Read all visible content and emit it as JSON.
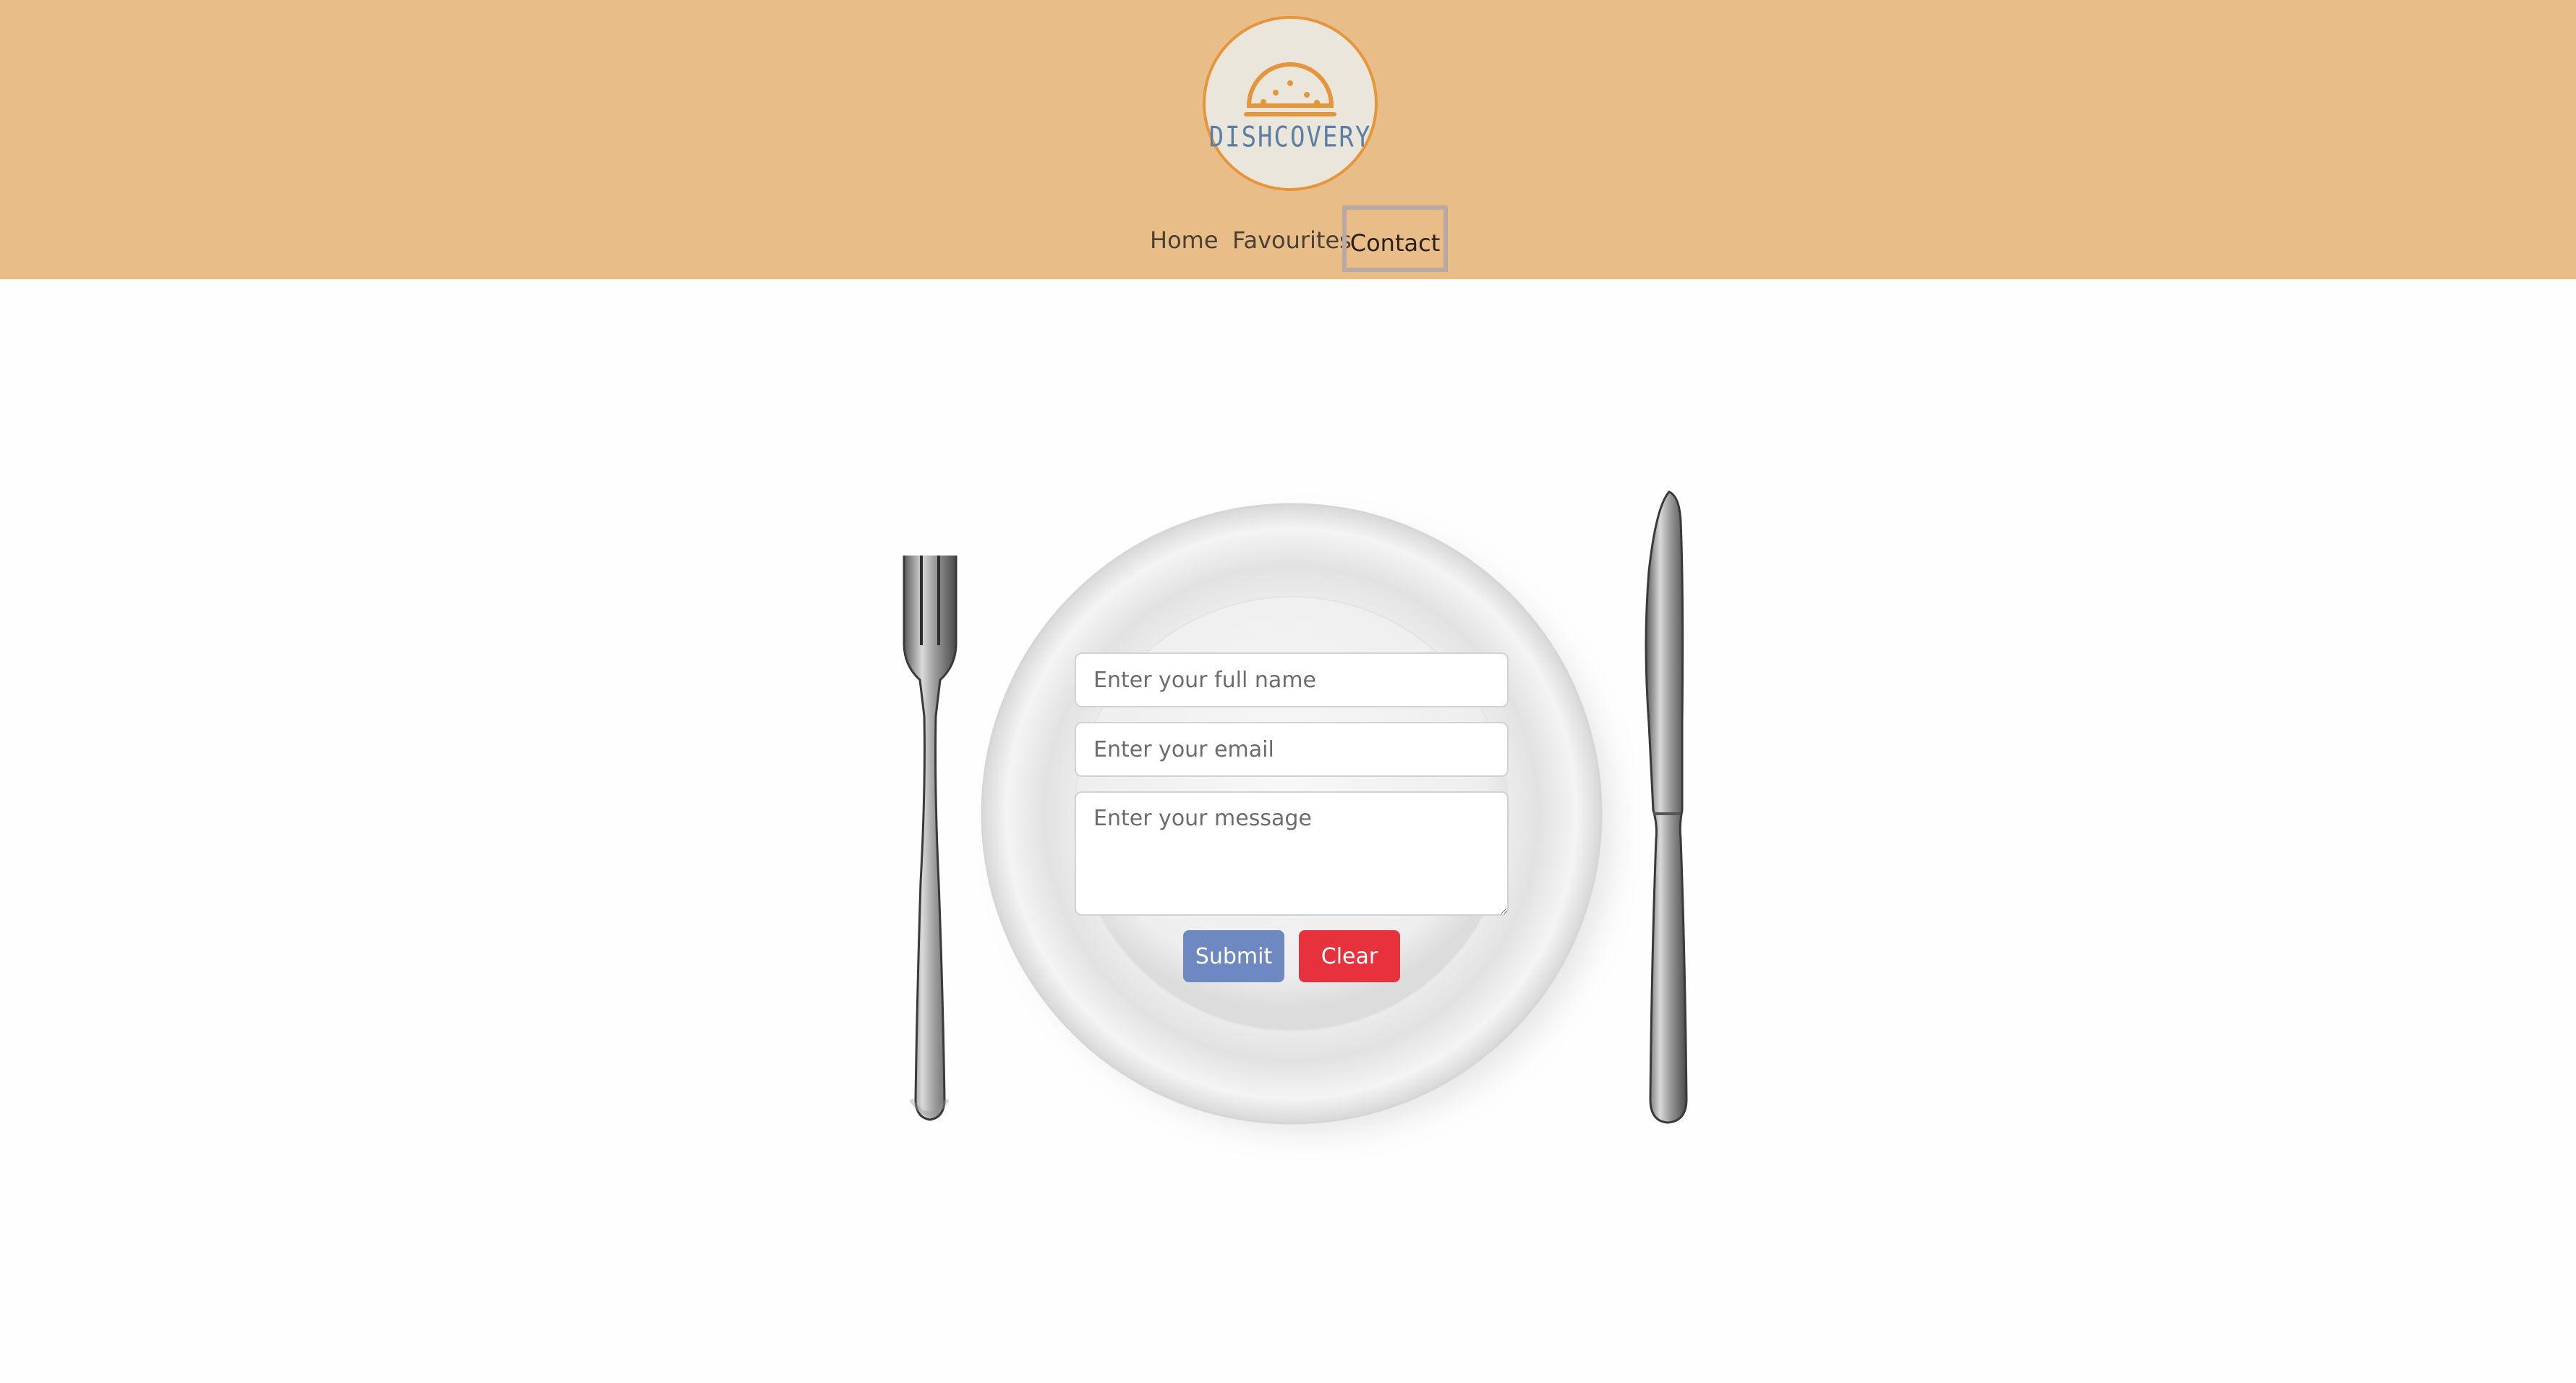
{
  "header": {
    "logo_text": "DISHCOVERY",
    "background_color": "#e9bd88"
  },
  "nav": {
    "items": [
      {
        "label": "Home"
      },
      {
        "label": "Favourites"
      },
      {
        "label": "Contact",
        "active": true
      }
    ]
  },
  "form": {
    "name_placeholder": "Enter your full name",
    "email_placeholder": "Enter your email",
    "message_placeholder": "Enter your message",
    "submit_label": "Submit",
    "clear_label": "Clear",
    "submit_color": "#6e89c1",
    "clear_color": "#e7323d"
  }
}
